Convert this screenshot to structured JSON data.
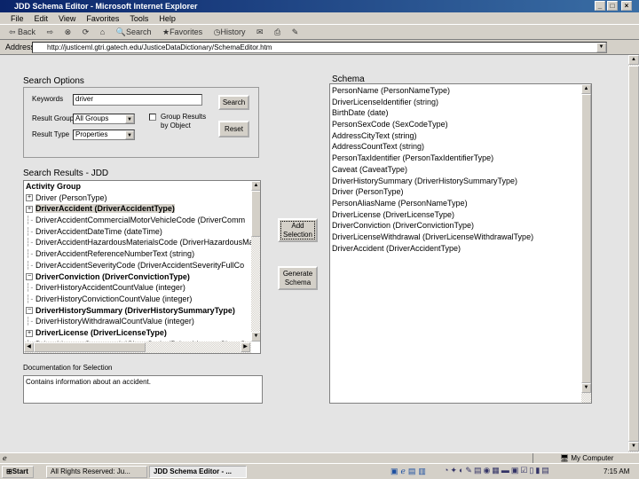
{
  "window": {
    "title": "JDD Schema Editor - Microsoft Internet Explorer"
  },
  "menu": [
    "File",
    "Edit",
    "View",
    "Favorites",
    "Tools",
    "Help"
  ],
  "toolbar": {
    "back": "Back",
    "search": "Search",
    "favorites": "Favorites",
    "history": "History"
  },
  "address": {
    "label": "Address",
    "url": "http://justiceml.gtri.gatech.edu/JusticeDataDictionary/SchemaEditor.htm"
  },
  "search_options": {
    "title": "Search Options",
    "keywords_label": "Keywords",
    "keywords_value": "driver",
    "result_group_label": "Result Group",
    "result_group_value": "All Groups",
    "result_type_label": "Result Type",
    "result_type_value": "Properties",
    "group_results_label": "Group Results by Object",
    "group_results_checked": false,
    "search_button": "Search",
    "reset_button": "Reset"
  },
  "search_results": {
    "title": "Search Results - JDD",
    "items": [
      {
        "text": "Activity Group",
        "bold": true,
        "kind": "header"
      },
      {
        "text": "Driver  (PersonType)",
        "bold": false,
        "kind": "expand"
      },
      {
        "text": "DriverAccident  (DriverAccidentType)",
        "bold": true,
        "kind": "expand",
        "selected": true
      },
      {
        "text": "DriverAccidentCommercialMotorVehicleCode  (DriverComm",
        "bold": false,
        "kind": "leaf"
      },
      {
        "text": "DriverAccidentDateTime  (dateTime)",
        "bold": false,
        "kind": "leaf"
      },
      {
        "text": "DriverAccidentHazardousMaterialsCode  (DriverHazardousMa",
        "bold": false,
        "kind": "leaf"
      },
      {
        "text": "DriverAccidentReferenceNumberText  (string)",
        "bold": false,
        "kind": "leaf"
      },
      {
        "text": "DriverAccidentSeverityCode  (DriverAccidentSeverityFullCo",
        "bold": false,
        "kind": "leaf"
      },
      {
        "text": "DriverConviction  (DriverConvictionType)",
        "bold": true,
        "kind": "collapse"
      },
      {
        "text": "DriverHistoryAccidentCountValue  (integer)",
        "bold": false,
        "kind": "leaf"
      },
      {
        "text": "DriverHistoryConvictionCountValue  (integer)",
        "bold": false,
        "kind": "leaf"
      },
      {
        "text": "DriverHistorySummary  (DriverHistorySummaryType)",
        "bold": true,
        "kind": "collapse"
      },
      {
        "text": "DriverHistoryWithdrawalCountValue  (integer)",
        "bold": false,
        "kind": "leaf"
      },
      {
        "text": "DriverLicense  (DriverLicenseType)",
        "bold": true,
        "kind": "expand"
      },
      {
        "text": "DriverLicenseCommercialClassCode  (DriverLicenseClassC",
        "bold": false,
        "kind": "leaf"
      }
    ]
  },
  "documentation": {
    "title": "Documentation for Selection",
    "text": "Contains information about an accident."
  },
  "actions": {
    "add_selection": "Add Selection",
    "generate_schema": "Generate Schema"
  },
  "schema": {
    "title": "Schema",
    "items": [
      "PersonName  (PersonNameType)",
      "DriverLicenseIdentifier  (string)",
      "BirthDate  (date)",
      "PersonSexCode  (SexCodeType)",
      "AddressCityText  (string)",
      "AddressCountText  (string)",
      "PersonTaxIdentifier  (PersonTaxIdentifierType)",
      "Caveat  (CaveatType)",
      "DriverHistorySummary  (DriverHistorySummaryType)",
      "Driver  (PersonType)",
      "PersonAliasName  (PersonNameType)",
      "DriverLicense  (DriverLicenseType)",
      "DriverConviction  (DriverConvictionType)",
      "DriverLicenseWithdrawal  (DriverLicenseWithdrawalType)",
      "DriverAccident  (DriverAccidentType)"
    ]
  },
  "statusbar": {
    "zone": "My Computer"
  },
  "taskbar": {
    "start": "Start",
    "tasks": [
      "All Rights Reserved: Ju...",
      "JDD Schema Editor - ..."
    ],
    "clock": "7:15 AM"
  },
  "colors": {
    "titlebar": "#0a246a",
    "content_bg": "#e4e4e4",
    "chrome": "#d4d0c8"
  }
}
